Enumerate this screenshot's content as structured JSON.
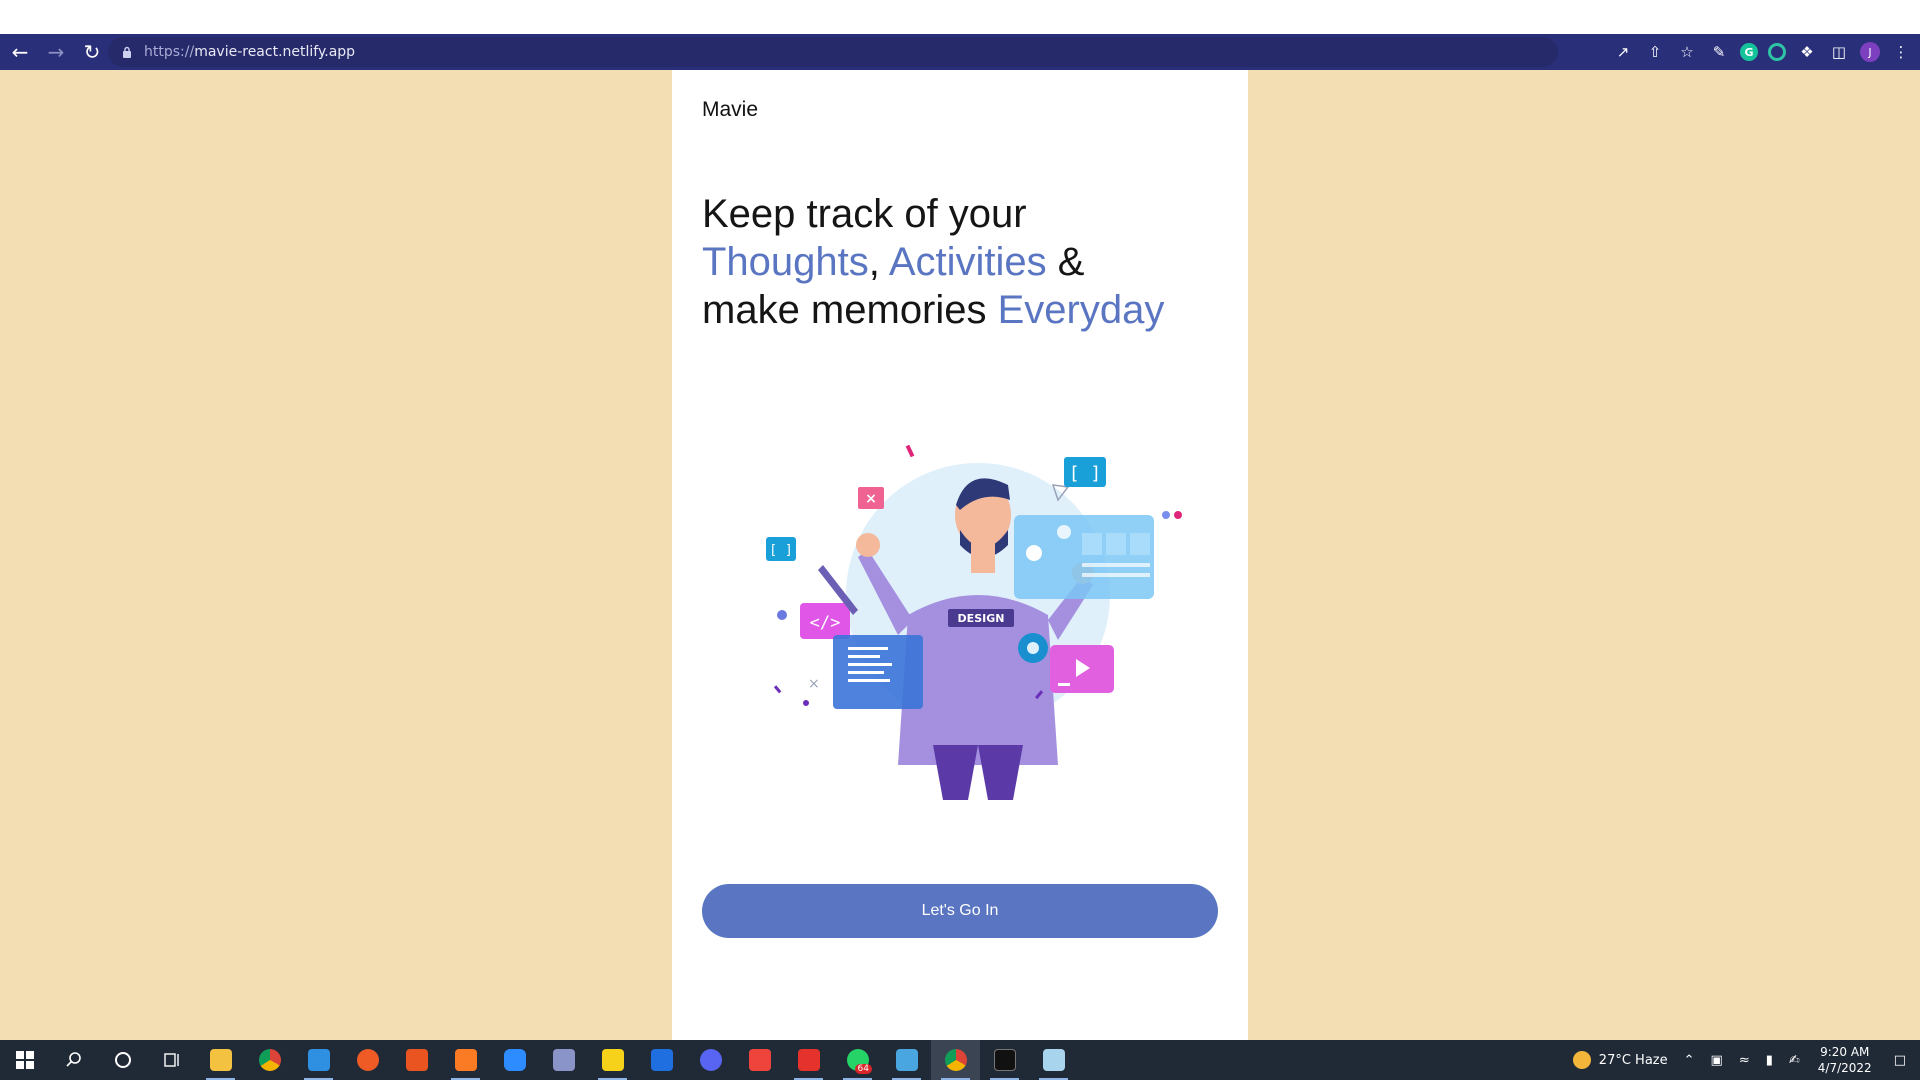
{
  "browser": {
    "url_scheme": "https://",
    "url_host": "mavie-react.netlify.app",
    "profile_initial": "J",
    "grammarly_letter": "G"
  },
  "page": {
    "brand": "Mavie",
    "headline": {
      "line1": "Keep track of your",
      "thoughts": "Thoughts",
      "comma": ",",
      "activities": "Activities",
      "amp": " &",
      "line3_start": "make memories ",
      "everyday": "Everyday"
    },
    "illustration_badge": "DESIGN",
    "cta_label": "Let's Go In",
    "colors": {
      "background": "#f3ddb3",
      "accent": "#5a75c1",
      "toolbar": "#2a2f7a"
    }
  },
  "taskbar": {
    "apps": [
      "start-icon",
      "search-icon",
      "cortana-icon",
      "task-view-icon",
      "file-explorer-icon",
      "chrome-icon",
      "vscode-icon",
      "postman-icon",
      "ubuntu-icon",
      "xampp-icon",
      "zoom-icon",
      "network-app-icon",
      "sticky-notes-icon",
      "trello-icon",
      "discord-icon",
      "anydesk-icon",
      "vivaldi-icon",
      "whatsapp-icon",
      "remote-desktop-icon",
      "chrome-profile-icon",
      "terminal-icon",
      "notepad-icon"
    ],
    "whatsapp_badge": "64",
    "weather": "27°C  Haze",
    "time": "9:20 AM",
    "date": "4/7/2022"
  }
}
